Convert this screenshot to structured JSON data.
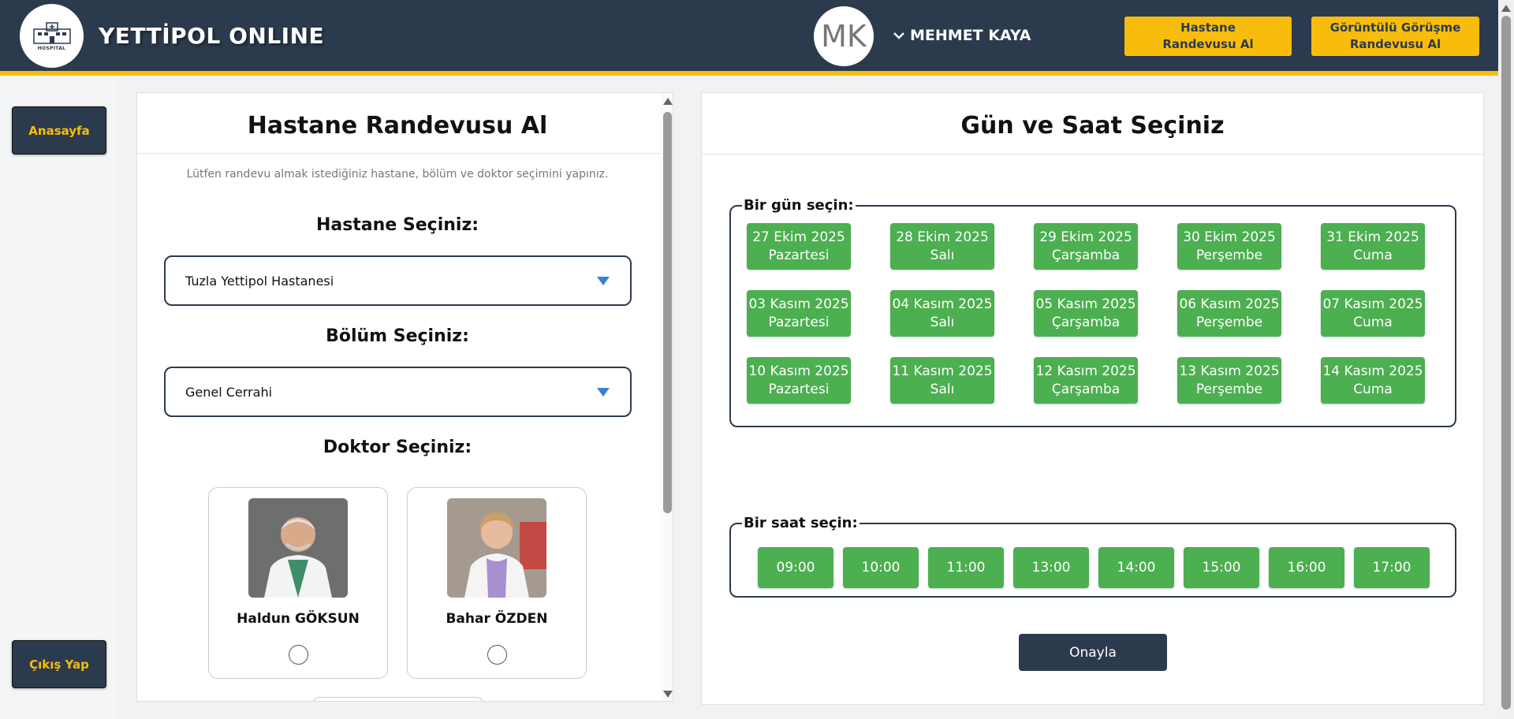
{
  "header": {
    "logo_text": "HOSPITAL",
    "brand": "YETTİPOL ONLINE",
    "avatar_initials": "MK",
    "user_name": "MEHMET KAYA",
    "btn_hospital": "Hastane\nRandevusu Al",
    "btn_video": "Görüntülü Görüşme\nRandevusu Al",
    "colors": {
      "navy": "#2c3a4d",
      "accent": "#f8bd0c"
    }
  },
  "sidebar": {
    "home": "Anasayfa",
    "logout": "Çıkış Yap"
  },
  "left": {
    "title": "Hastane Randevusu Al",
    "note": "Lütfen randevu almak istediğiniz hastane, bölüm ve doktor seçimini yapınız.",
    "hospital_label": "Hastane Seçiniz:",
    "hospital_value": "Tuzla Yettipol Hastanesi",
    "department_label": "Bölüm Seçiniz:",
    "department_value": "Genel Cerrahi",
    "doctor_label": "Doktor Seçiniz:",
    "doctors": [
      {
        "name": "Haldun GÖKSUN"
      },
      {
        "name": "Bahar ÖZDEN"
      }
    ]
  },
  "right": {
    "title": "Gün ve Saat Seçiniz",
    "day_legend": "Bir gün seçin:",
    "time_legend": "Bir saat seçin:",
    "days": [
      {
        "date": "27 Ekim 2025",
        "weekday": "Pazartesi"
      },
      {
        "date": "28 Ekim 2025",
        "weekday": "Salı"
      },
      {
        "date": "29 Ekim 2025",
        "weekday": "Çarşamba"
      },
      {
        "date": "30 Ekim 2025",
        "weekday": "Perşembe"
      },
      {
        "date": "31 Ekim 2025",
        "weekday": "Cuma"
      },
      {
        "date": "03 Kasım 2025",
        "weekday": "Pazartesi"
      },
      {
        "date": "04 Kasım 2025",
        "weekday": "Salı"
      },
      {
        "date": "05 Kasım 2025",
        "weekday": "Çarşamba"
      },
      {
        "date": "06 Kasım 2025",
        "weekday": "Perşembe"
      },
      {
        "date": "07 Kasım 2025",
        "weekday": "Cuma"
      },
      {
        "date": "10 Kasım 2025",
        "weekday": "Pazartesi"
      },
      {
        "date": "11 Kasım 2025",
        "weekday": "Salı"
      },
      {
        "date": "12 Kasım 2025",
        "weekday": "Çarşamba"
      },
      {
        "date": "13 Kasım 2025",
        "weekday": "Perşembe"
      },
      {
        "date": "14 Kasım 2025",
        "weekday": "Cuma"
      }
    ],
    "times": [
      "09:00",
      "10:00",
      "11:00",
      "13:00",
      "14:00",
      "15:00",
      "16:00",
      "17:00"
    ],
    "confirm": "Onayla",
    "slot_color": "#4caf50"
  }
}
